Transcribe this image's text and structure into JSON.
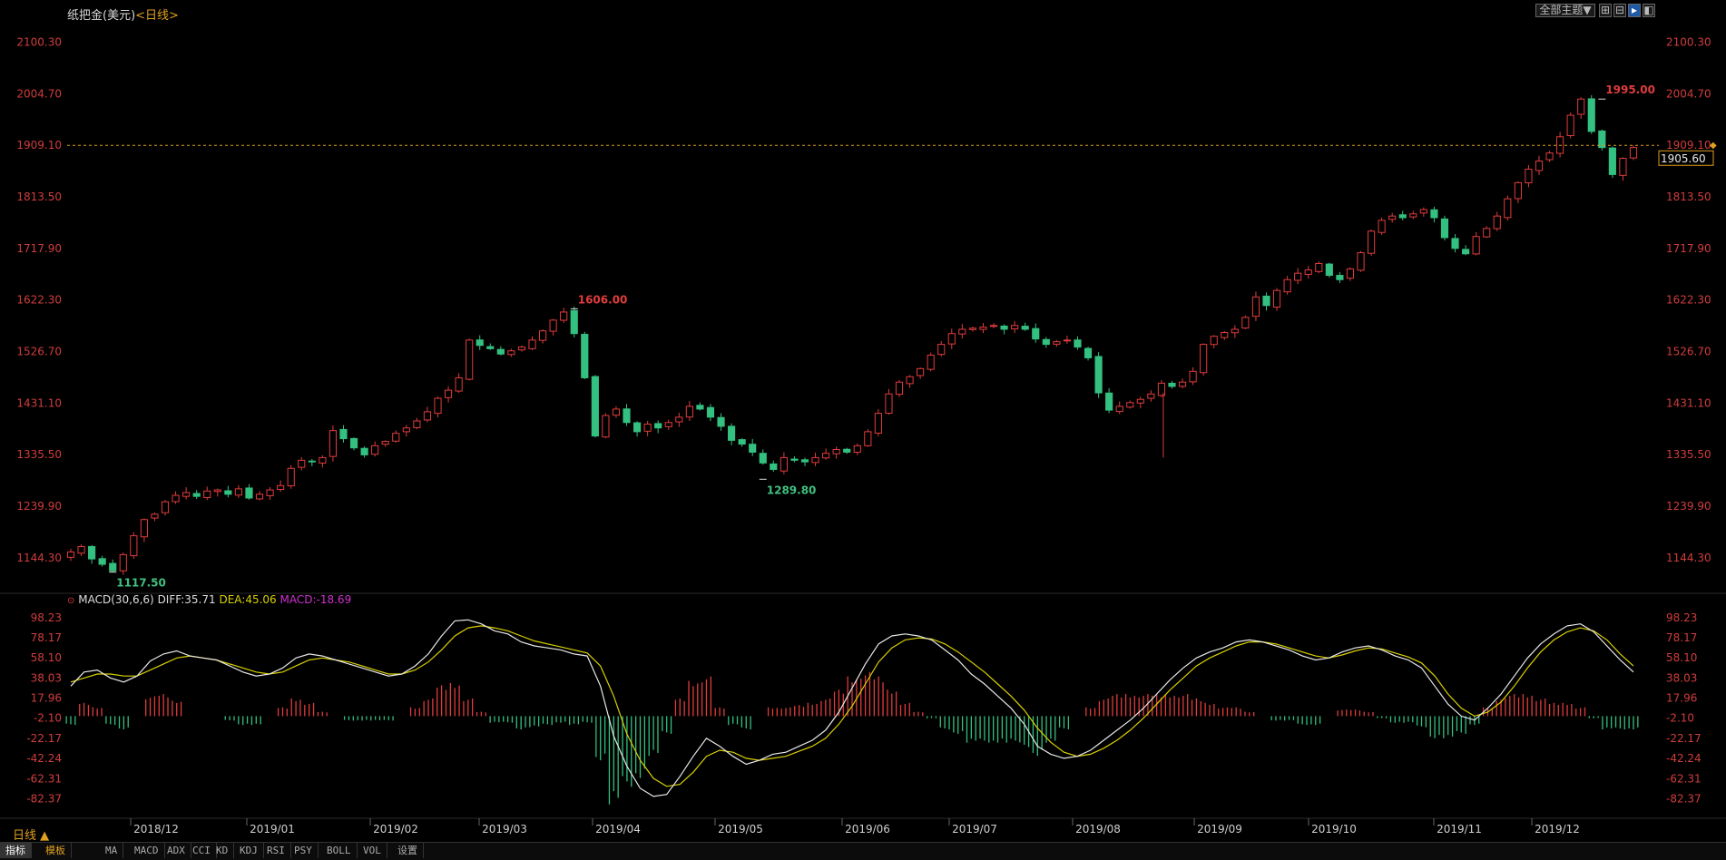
{
  "header": {
    "instrument": "纸把金(美元)",
    "period_bracket": "<日线>",
    "theme_button": "全部主题▼"
  },
  "price_axis": {
    "ticks": [
      "2100.30",
      "2004.70",
      "1909.10",
      "1813.50",
      "1717.90",
      "1622.30",
      "1526.70",
      "1431.10",
      "1335.50",
      "1239.90",
      "1144.30"
    ],
    "min": 1085,
    "max": 2135,
    "last_price": "1905.60",
    "reference_line": "1909.10"
  },
  "macd": {
    "label": "MACD(30,6,6)",
    "diff_text": "DIFF:35.71",
    "dea_text": "DEA:45.06",
    "macd_text": "MACD:-18.69",
    "ticks": [
      "98.23",
      "78.17",
      "58.10",
      "38.03",
      "17.96",
      "-2.10",
      "-22.17",
      "-42.24",
      "-62.31",
      "-82.37"
    ],
    "min": -100,
    "max": 108,
    "colors": {
      "diff": "#e8e8e8",
      "dea": "#d8d000",
      "up": "#e03c3c",
      "down": "#33c080"
    }
  },
  "time_axis": [
    "2018/12",
    "2019/01",
    "2019/02",
    "2019/03",
    "2019/04",
    "2019/05",
    "2019/06",
    "2019/07",
    "2019/08",
    "2019/09",
    "2019/10",
    "2019/11",
    "2019/12"
  ],
  "footer": {
    "period": "日线 ▲",
    "tabs": [
      "指标",
      "模板",
      "MA",
      "MACD",
      "ADX",
      "CCI",
      "KD",
      "KDJ",
      "RSI",
      "PSY",
      "BOLL",
      "VOL",
      "设置"
    ]
  },
  "chart_data": [
    {
      "type": "candlestick",
      "title": "纸把金(美元)",
      "ylim": [
        1085,
        2135
      ],
      "annotations": [
        {
          "label": "1117.50",
          "value": 1117.5,
          "date": "2018/11"
        },
        {
          "label": "1606.00",
          "value": 1606.0,
          "date": "2019/03"
        },
        {
          "label": "1289.80",
          "value": 1289.8,
          "date": "2019/05"
        },
        {
          "label": "1995.00",
          "value": 1995.0,
          "date": "2019/12"
        }
      ],
      "close_path": [
        1155,
        1165,
        1142,
        1132,
        1120,
        1150,
        1185,
        1215,
        1225,
        1248,
        1260,
        1265,
        1258,
        1268,
        1270,
        1262,
        1272,
        1255,
        1262,
        1270,
        1278,
        1310,
        1325,
        1322,
        1330,
        1380,
        1365,
        1348,
        1335,
        1352,
        1360,
        1375,
        1385,
        1398,
        1415,
        1440,
        1455,
        1478,
        1548,
        1538,
        1532,
        1522,
        1528,
        1535,
        1548,
        1565,
        1585,
        1600,
        1560,
        1478,
        1370,
        1408,
        1420,
        1395,
        1378,
        1392,
        1385,
        1395,
        1405,
        1425,
        1420,
        1405,
        1388,
        1362,
        1355,
        1340,
        1320,
        1308,
        1330,
        1325,
        1322,
        1330,
        1338,
        1345,
        1340,
        1352,
        1378,
        1412,
        1448,
        1470,
        1480,
        1495,
        1520,
        1540,
        1560,
        1568,
        1570,
        1572,
        1575,
        1568,
        1575,
        1568,
        1550,
        1540,
        1545,
        1548,
        1535,
        1515,
        1450,
        1418,
        1425,
        1432,
        1438,
        1448,
        1468,
        1462,
        1470,
        1490,
        1540,
        1555,
        1562,
        1568,
        1590,
        1628,
        1612,
        1640,
        1660,
        1672,
        1678,
        1690,
        1668,
        1660,
        1680,
        1710,
        1750,
        1770,
        1778,
        1775,
        1782,
        1790,
        1775,
        1738,
        1718,
        1708,
        1740,
        1755,
        1778,
        1810,
        1840,
        1865,
        1880,
        1895,
        1925,
        1965,
        1995,
        1935,
        1905,
        1855,
        1885,
        1905
      ],
      "x_range": [
        "2018/11",
        "2019/12"
      ]
    },
    {
      "type": "line+bar",
      "title": "MACD(30,6,6)",
      "series": [
        {
          "name": "DIFF",
          "values": [
            30,
            44,
            46,
            38,
            34,
            40,
            55,
            62,
            65,
            60,
            58,
            56,
            50,
            44,
            40,
            42,
            48,
            58,
            62,
            60,
            56,
            52,
            48,
            44,
            40,
            42,
            50,
            62,
            80,
            95,
            96,
            92,
            85,
            82,
            74,
            70,
            68,
            66,
            62,
            60,
            30,
            -20,
            -50,
            -72,
            -80,
            -78,
            -60,
            -40,
            -22,
            -30,
            -40,
            -48,
            -44,
            -38,
            -36,
            -30,
            -24,
            -14,
            4,
            28,
            52,
            72,
            80,
            82,
            80,
            76,
            66,
            56,
            42,
            32,
            20,
            8,
            -8,
            -30,
            -38,
            -42,
            -40,
            -34,
            -24,
            -14,
            -4,
            8,
            22,
            36,
            48,
            58,
            64,
            68,
            74,
            76,
            74,
            70,
            66,
            60,
            56,
            58,
            64,
            68,
            70,
            66,
            60,
            56,
            48,
            30,
            12,
            0,
            -4,
            8,
            22,
            40,
            58,
            72,
            82,
            90,
            92,
            84,
            70,
            56,
            44
          ],
          "note_end": 35.71
        },
        {
          "name": "DEA",
          "values": [
            34,
            38,
            42,
            42,
            40,
            40,
            46,
            52,
            58,
            60,
            58,
            56,
            52,
            48,
            44,
            42,
            44,
            50,
            56,
            58,
            56,
            54,
            50,
            46,
            42,
            42,
            46,
            54,
            66,
            80,
            88,
            90,
            88,
            85,
            80,
            75,
            72,
            69,
            66,
            63,
            50,
            20,
            -18,
            -44,
            -62,
            -70,
            -68,
            -56,
            -40,
            -34,
            -36,
            -42,
            -44,
            -42,
            -40,
            -35,
            -30,
            -22,
            -8,
            10,
            32,
            54,
            68,
            76,
            78,
            77,
            72,
            64,
            54,
            44,
            32,
            20,
            6,
            -12,
            -26,
            -36,
            -40,
            -38,
            -32,
            -24,
            -14,
            -2,
            12,
            26,
            38,
            50,
            58,
            64,
            70,
            74,
            74,
            72,
            68,
            64,
            60,
            58,
            61,
            65,
            68,
            67,
            63,
            59,
            53,
            40,
            22,
            8,
            0,
            4,
            14,
            30,
            48,
            64,
            76,
            84,
            88,
            85,
            76,
            62,
            50
          ],
          "note_end": 45.06
        },
        {
          "name": "MACD",
          "values": [
            -4,
            6,
            4,
            -4,
            -6,
            0,
            9,
            10,
            7,
            0,
            0,
            0,
            -2,
            -4,
            -4,
            0,
            4,
            8,
            6,
            2,
            0,
            -2,
            -2,
            -2,
            -2,
            0,
            4,
            8,
            14,
            15,
            8,
            2,
            -3,
            -3,
            -6,
            -5,
            -4,
            -3,
            -4,
            -3,
            -20,
            -40,
            -32,
            -28,
            -18,
            -8,
            8,
            16,
            18,
            4,
            -4,
            -6,
            0,
            4,
            4,
            5,
            6,
            8,
            12,
            18,
            20,
            18,
            12,
            6,
            2,
            -1,
            -6,
            -8,
            -12,
            -12,
            -12,
            -12,
            -14,
            -18,
            -12,
            -6,
            0,
            4,
            8,
            10,
            10,
            10,
            10,
            10,
            10,
            8,
            6,
            4,
            4,
            2,
            0,
            -2,
            -2,
            -4,
            -4,
            0,
            3,
            3,
            2,
            -1,
            -3,
            -3,
            -5,
            -10,
            -10,
            -8,
            -4,
            4,
            8,
            10,
            10,
            8,
            6,
            6,
            4,
            -1,
            -6,
            -6,
            -6
          ],
          "note_end": -18.69
        }
      ],
      "ylim": [
        -100,
        108
      ]
    }
  ]
}
